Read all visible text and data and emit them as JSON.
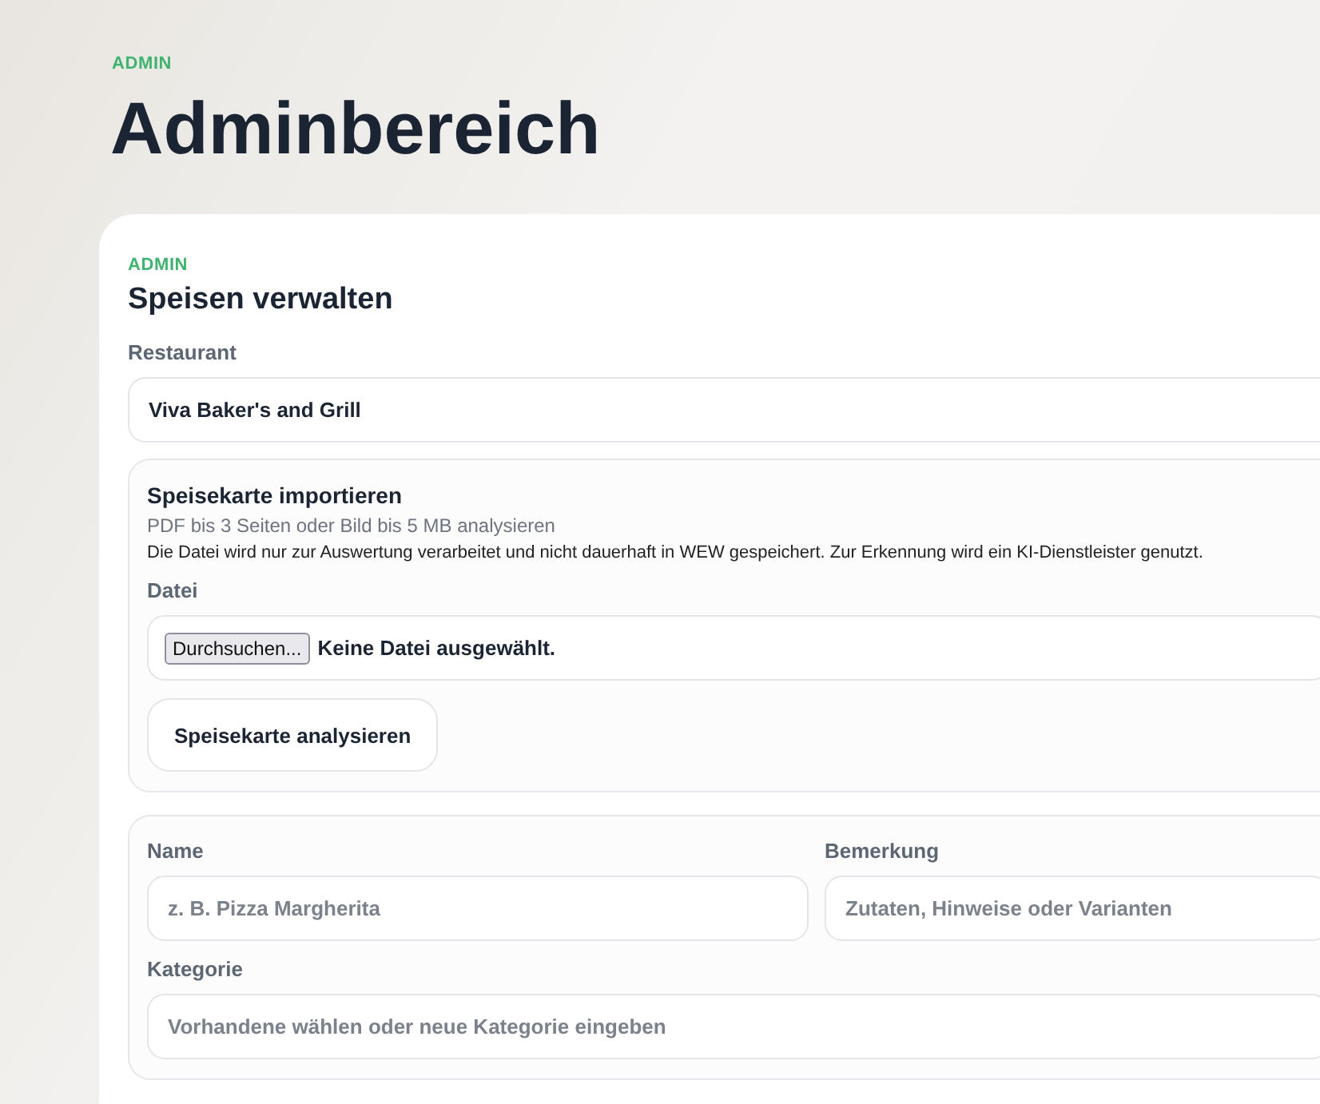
{
  "page": {
    "eyebrow": "ADMIN",
    "title": "Adminbereich"
  },
  "card": {
    "eyebrow": "ADMIN",
    "title": "Speisen verwalten",
    "restaurant": {
      "label": "Restaurant",
      "value": "Viva Baker's and Grill"
    },
    "import": {
      "title": "Speisekarte importieren",
      "subtitle": "PDF bis 3 Seiten oder Bild bis 5 MB analysieren",
      "note": "Die Datei wird nur zur Auswertung verarbeitet und nicht dauerhaft in WEW gespeichert. Zur Erkennung wird ein KI-Dienstleister genutzt.",
      "file_label": "Datei",
      "browse_button": "Durchsuchen...",
      "file_status": "Keine Datei ausgewählt.",
      "analyze_button": "Speisekarte analysieren"
    },
    "dish_form": {
      "name": {
        "label": "Name",
        "placeholder": "z. B. Pizza Margherita"
      },
      "remark": {
        "label": "Bemerkung",
        "placeholder": "Zutaten, Hinweise oder Varianten"
      },
      "category": {
        "label": "Kategorie",
        "placeholder": "Vorhandene wählen oder neue Kategorie eingeben"
      }
    }
  }
}
